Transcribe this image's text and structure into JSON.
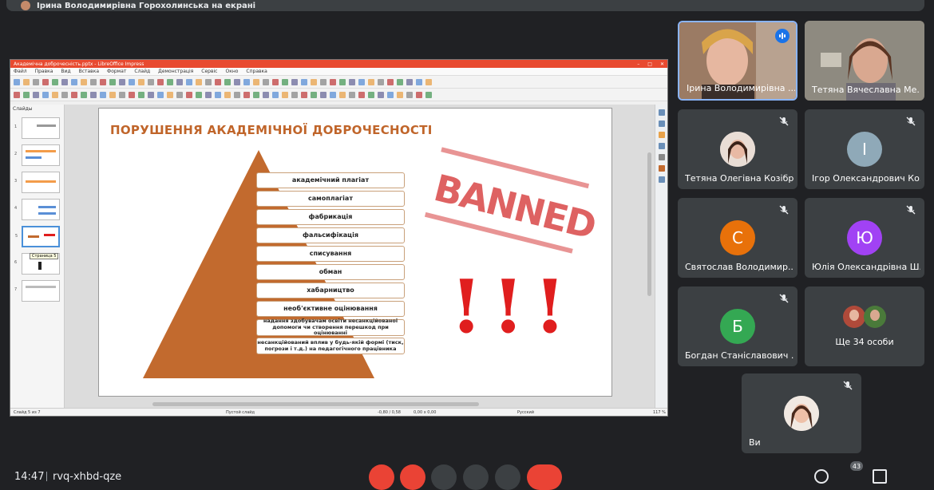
{
  "top_banner": {
    "text": "Ірина Володимирівна Горохолинська на екрані"
  },
  "lo": {
    "title": "Академічна доброчесність.pptx - LibreOffice Impress",
    "menu": [
      "Файл",
      "Правка",
      "Вид",
      "Вставка",
      "Формат",
      "Слайд",
      "Демонстрація",
      "Сервіс",
      "Окно",
      "Справка"
    ],
    "slides_panel_title": "Слайды",
    "slide_numbers": [
      "1",
      "2",
      "3",
      "4",
      "5",
      "6",
      "7"
    ],
    "tooltip": "Страница 5",
    "status": {
      "slide": "Слайд 5 из 7",
      "layout": "Пустой слайд",
      "coords": "-0,80 / 0,58",
      "size": "0,00 x 0,00",
      "lang": "Русский",
      "zoom": "117 %"
    }
  },
  "slide": {
    "title": "ПОРУШЕННЯ АКАДЕМІЧНОЇ ДОБРОЧЕСНОСТІ",
    "items": [
      "академічний плагіат",
      "самоплагіат",
      "фабрикація",
      "фальсифікація",
      "списування",
      "обман",
      "хабарництво",
      "необ'єктивне оцінювання",
      "надання здобувачам освіти несанкційованої допомоги чи створення перешкод при оцінюванні",
      "несанкційований вплив у будь-якій формі (тиск, погрози і т.д.) на педагогічного працівника"
    ],
    "stamp": "BANNED",
    "exclamations": "!!!"
  },
  "participants": [
    {
      "name": "Ірина Володимирівна ...",
      "type": "video"
    },
    {
      "name": "Тетяна Вячеславна Ме...",
      "type": "video"
    },
    {
      "name": "Тетяна Олегівна Козібр...",
      "type": "photo"
    },
    {
      "name": "Ігор Олександрович Ко...",
      "type": "letter",
      "initial": "І",
      "color": "#8fa9b8"
    },
    {
      "name": "Святослав Володимир...",
      "type": "letter",
      "initial": "С",
      "color": "#e8710a"
    },
    {
      "name": "Юлія Олександрівна Ш...",
      "type": "letter",
      "initial": "Ю",
      "color": "#a142f4"
    },
    {
      "name": "Богдан Станіславович ...",
      "type": "letter",
      "initial": "Б",
      "color": "#34a853"
    },
    {
      "name": "Ще 34 особи",
      "type": "group"
    },
    {
      "name": "Ви",
      "type": "photo"
    }
  ],
  "bottom": {
    "time": "14:47",
    "meeting_code": "rvq-xhbd-qze",
    "participant_count": "43"
  },
  "colors": {
    "pyramid": "#c26a2e",
    "stamp": "#d63c3c",
    "alert": "#e01e1e",
    "title": "#c0652a"
  }
}
